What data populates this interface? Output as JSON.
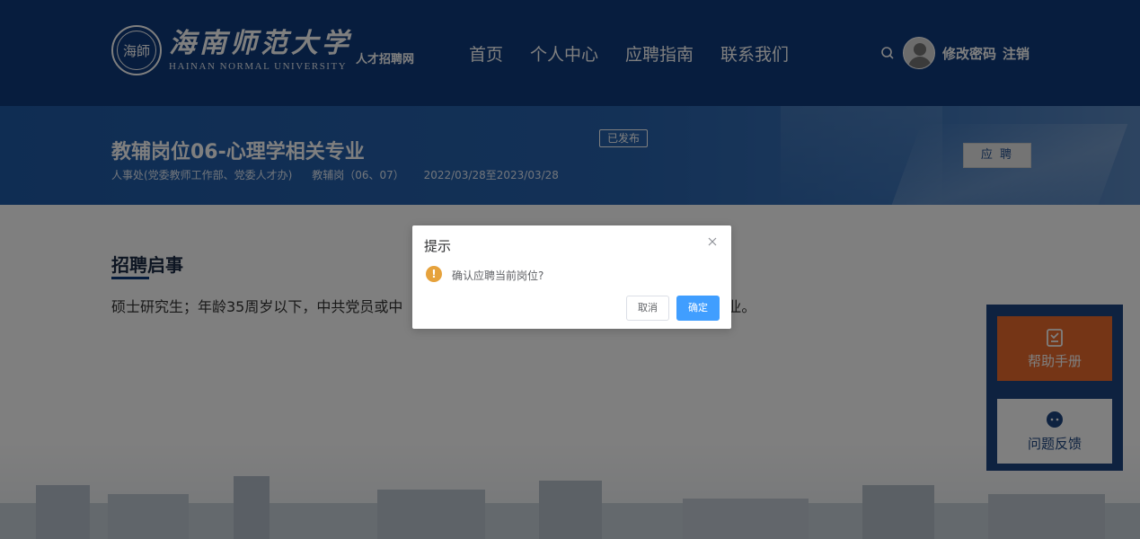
{
  "header": {
    "logo_seal_text": "海師",
    "logo_cn": "海南师范大学",
    "logo_en": "HAINAN NORMAL UNIVERSITY",
    "logo_sub": "人才招聘网",
    "nav": [
      "首页",
      "个人中心",
      "应聘指南",
      "联系我们"
    ],
    "change_password": "修改密码",
    "logout": "注销"
  },
  "job": {
    "title": "教辅岗位06-心理学相关专业",
    "status": "已发布",
    "department": "人事处(党委教师工作部、党委人才办)",
    "post_type": "教辅岗（06、07）",
    "date_range": "2022/03/28至2023/03/28",
    "apply_label": "应 聘"
  },
  "section": {
    "title": "招聘启事",
    "description_left": "硕士研究生；年龄35周岁以下，中共党员或中",
    "description_right": "专业。"
  },
  "side": {
    "help_label": "帮助手册",
    "feedback_label": "问题反馈"
  },
  "dialog": {
    "title": "提示",
    "icon_glyph": "!",
    "message": "确认应聘当前岗位?",
    "cancel": "取消",
    "confirm": "确定"
  },
  "colors": {
    "header_bg": "#0e3a7c",
    "banner_bg": "#2762ad",
    "help_btn": "#ea6a2c",
    "primary_btn": "#409eff",
    "warning": "#e6a23c"
  }
}
